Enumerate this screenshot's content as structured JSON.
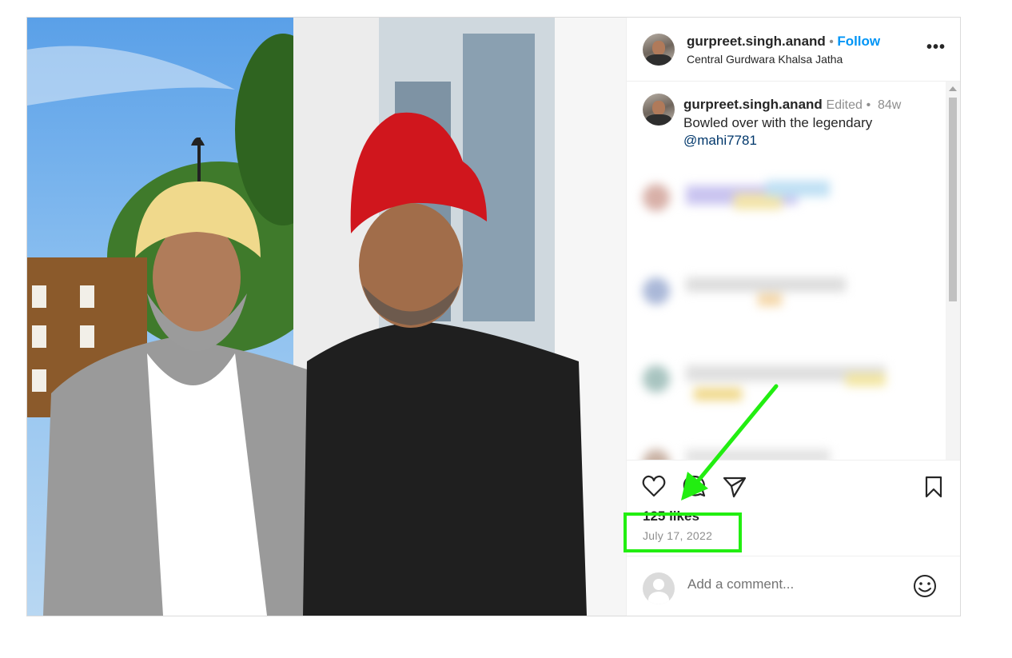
{
  "post": {
    "header": {
      "username": "gurpreet.singh.anand",
      "separator": "•",
      "follow_label": "Follow",
      "location": "Central Gurdwara Khalsa Jatha",
      "more_icon": "more-horizontal-icon"
    },
    "caption": {
      "username": "gurpreet.singh.anand",
      "edited_label": "Edited",
      "separator": "•",
      "age": "84w",
      "text": "Bowled over with the legendary",
      "mention": "@mahi7781"
    },
    "actions": {
      "like_icon": "heart-icon",
      "comment_icon": "comment-icon",
      "share_icon": "send-icon",
      "save_icon": "bookmark-icon"
    },
    "likes_text": "125 likes",
    "date_text": "July 17, 2022",
    "comment_box": {
      "placeholder": "Add a comment...",
      "emoji_icon": "smiley-icon"
    }
  },
  "annotation": {
    "arrow_color": "#22ee11",
    "box_color": "#22ee11"
  }
}
